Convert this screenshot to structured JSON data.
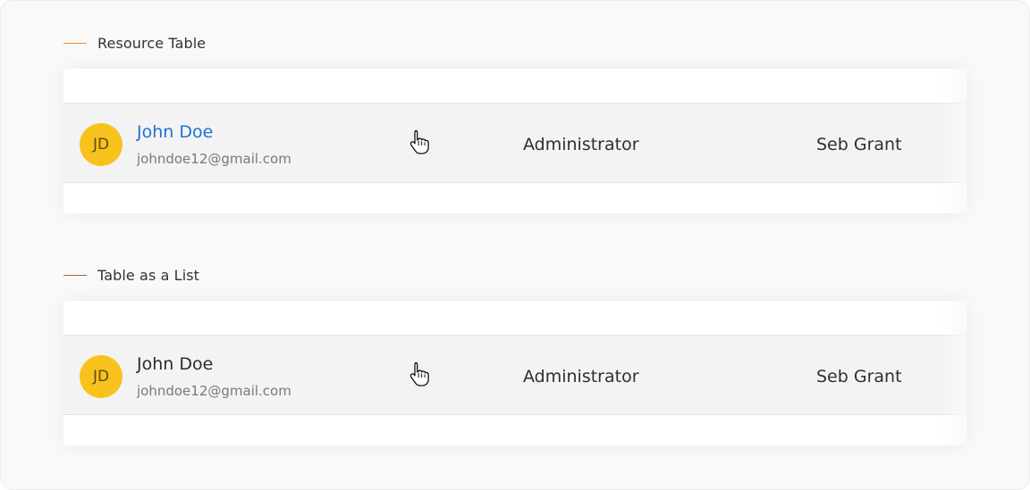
{
  "colors": {
    "accent_line_a": "#e58a2b",
    "accent_line_b": "#9b6b3c",
    "avatar_bg": "#f8c21c",
    "link": "#1f74d2"
  },
  "sections": [
    {
      "title": "Resource Table",
      "row": {
        "avatar_initials": "JD",
        "name": "John Doe",
        "email": "johndoe12@gmail.com",
        "role": "Administrator",
        "owner": "Seb Grant"
      }
    },
    {
      "title": "Table as a List",
      "row": {
        "avatar_initials": "JD",
        "name": "John Doe",
        "email": "johndoe12@gmail.com",
        "role": "Administrator",
        "owner": "Seb Grant"
      }
    }
  ],
  "icons": {
    "cursor": "hand-pointer-icon"
  }
}
